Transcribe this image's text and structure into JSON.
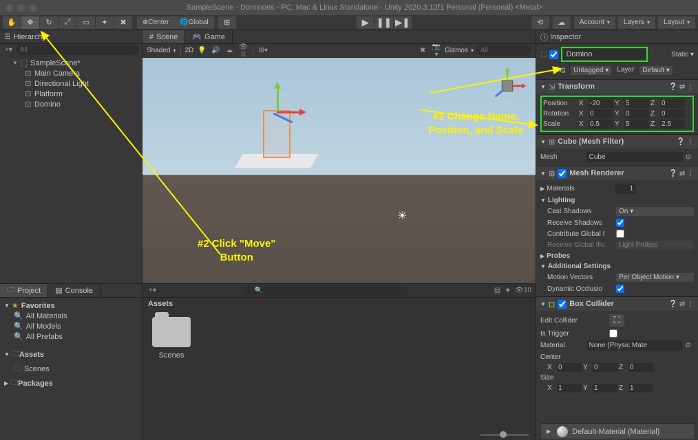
{
  "titlebar": "SampleScene - Dominoes - PC, Mac & Linux Standalone - Unity 2020.3.12f1 Personal (Personal) <Metal>",
  "toolbar": {
    "center": "Center",
    "global": "Global",
    "account": "Account",
    "layers": "Layers",
    "layout": "Layout"
  },
  "hierarchy": {
    "title": "Hierarchy",
    "search_ph": "All",
    "scene": "SampleScene*",
    "items": [
      "Main Camera",
      "Directional Light",
      "Platform",
      "Domino"
    ]
  },
  "sceneTabs": {
    "scene": "Scene",
    "game": "Game"
  },
  "sceneToolbar": {
    "shaded": "Shaded",
    "twoD": "2D",
    "gizmos": "Gizmos",
    "search_ph": "All"
  },
  "annotations": {
    "anno1a": "#1 Change Name,",
    "anno1b": "Position, and Scale",
    "anno2a": "#2 Click \"Move\"",
    "anno2b": "Button"
  },
  "project": {
    "projectTab": "Project",
    "consoleTab": "Console",
    "favorites": "Favorites",
    "favItems": [
      "All Materials",
      "All Models",
      "All Prefabs"
    ],
    "assets": "Assets",
    "assetsItems": [
      "Scenes"
    ],
    "packages": "Packages"
  },
  "assets": {
    "breadcrumb": "Assets",
    "scenesFolder": "Scenes",
    "hidden": "10"
  },
  "inspector": {
    "title": "Inspector",
    "name": "Domino",
    "static": "Static",
    "tagLabel": "Tag",
    "tagValue": "Untagged",
    "layerLabel": "Layer",
    "layerValue": "Default",
    "transform": {
      "title": "Transform",
      "posLabel": "Position",
      "rotLabel": "Rotation",
      "scaleLabel": "Scale",
      "pos": {
        "x": "-20",
        "y": "5",
        "z": "0"
      },
      "rot": {
        "x": "0",
        "y": "0",
        "z": "0"
      },
      "scale": {
        "x": "0.5",
        "y": "5",
        "z": "2.5"
      }
    },
    "meshFilter": {
      "title": "Cube (Mesh Filter)",
      "meshLabel": "Mesh",
      "meshValue": "Cube"
    },
    "meshRenderer": {
      "title": "Mesh Renderer",
      "materials": "Materials",
      "materialsCount": "1",
      "lighting": "Lighting",
      "castShadows": "Cast Shadows",
      "castShadowsValue": "On",
      "receiveShadows": "Receive Shadows",
      "contributeGI": "Contribute Global I",
      "receiveGI": "Receive Global Illu",
      "receiveGIValue": "Light Probes",
      "probes": "Probes",
      "additional": "Additional Settings",
      "motionVectors": "Motion Vectors",
      "motionVectorsValue": "Per Object Motion",
      "dynamicOcc": "Dynamic Occlusio"
    },
    "boxCollider": {
      "title": "Box Collider",
      "editCollider": "Edit Collider",
      "isTrigger": "Is Trigger",
      "material": "Material",
      "materialValue": "None (Physic Mate",
      "center": "Center",
      "centerVals": {
        "x": "0",
        "y": "0",
        "z": "0"
      },
      "size": "Size",
      "sizeVals": {
        "x": "1",
        "y": "1",
        "z": "1"
      }
    },
    "defaultMaterial": "Default-Material (Material)"
  }
}
